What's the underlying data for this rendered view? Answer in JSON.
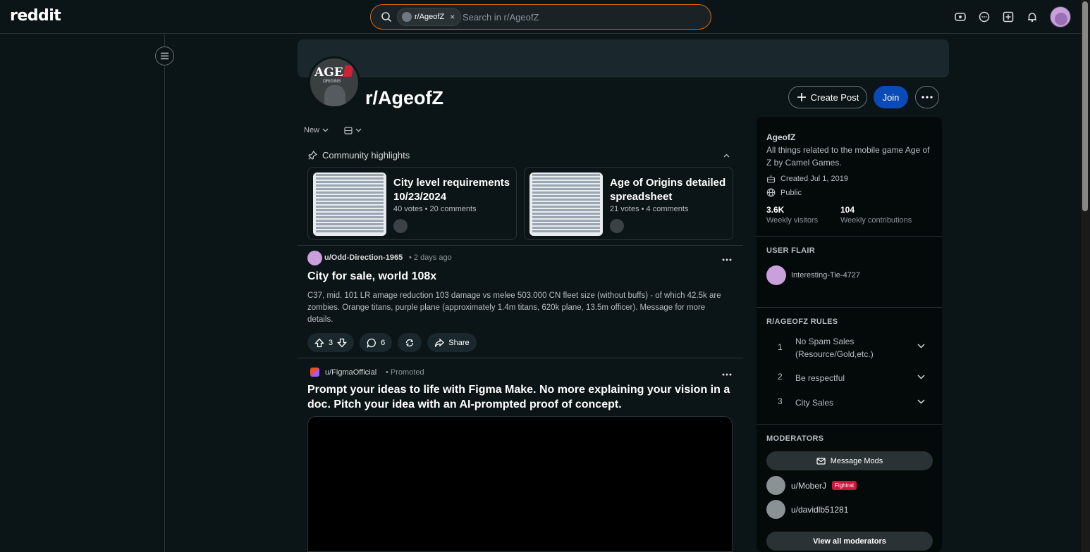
{
  "header": {
    "logo": "reddit",
    "search_chip": "r/AgeofZ",
    "search_chip_close": "×",
    "search_placeholder": "Search in r/AgeofZ",
    "icons": [
      "advertise-icon",
      "chat-icon",
      "create-post-icon",
      "notifications-icon"
    ]
  },
  "subreddit": {
    "avatar_text_main": "AGE",
    "avatar_text_sub": "ORIGINS",
    "name": "r/AgeofZ",
    "create_post": "Create Post",
    "join": "Join"
  },
  "sort": {
    "label": "New"
  },
  "highlights": {
    "heading": "Community highlights",
    "cards": [
      {
        "title": "City level requirements 10/23/2024",
        "meta": "40 votes • 20 comments"
      },
      {
        "title": "Age of Origins detailed spreadsheet",
        "meta": "21 votes • 4 comments"
      }
    ]
  },
  "post": {
    "user": "u/Odd-Direction-1965",
    "time": "• 2 days ago",
    "title": "City for sale, world 108x",
    "body": "C37, mid. 101 LR amage reduction 103 damage vs melee 503.000 CN fleet size (without buffs) - of which 42.5k are zombies. Orange titans, purple plane (approximately 1.4m titans, 620k plane, 13.5m officer). Message for more details.",
    "votes": "3",
    "comments": "6",
    "share": "Share"
  },
  "ad": {
    "user": "u/FigmaOfficial",
    "promoted": "• Promoted",
    "title": "Prompt your ideas to life with Figma Make. No more explaining your vision in a doc. Pitch your idea with an AI-prompted proof of concept."
  },
  "sidebar": {
    "name": "AgeofZ",
    "description": "All things related to the mobile game Age of Z by Camel Games.",
    "created": "Created Jul 1, 2019",
    "visibility": "Public",
    "visitors_value": "3.6K",
    "visitors_label": "Weekly visitors",
    "contrib_value": "104",
    "contrib_label": "Weekly contributions",
    "flair_heading": "USER FLAIR",
    "flair_user": "Interesting-Tie-4727",
    "rules_heading": "R/AGEOFZ RULES",
    "rules": [
      {
        "num": "1",
        "text": "No Spam Sales (Resource/Gold,etc.)"
      },
      {
        "num": "2",
        "text": "Be respectful"
      },
      {
        "num": "3",
        "text": "City Sales"
      }
    ],
    "mods_heading": "MODERATORS",
    "message_mods": "Message Mods",
    "mods": [
      {
        "name": "u/MoberJ",
        "badge": "Fightrat"
      },
      {
        "name": "u/davidlb51281",
        "badge": ""
      }
    ],
    "view_all": "View all moderators"
  }
}
